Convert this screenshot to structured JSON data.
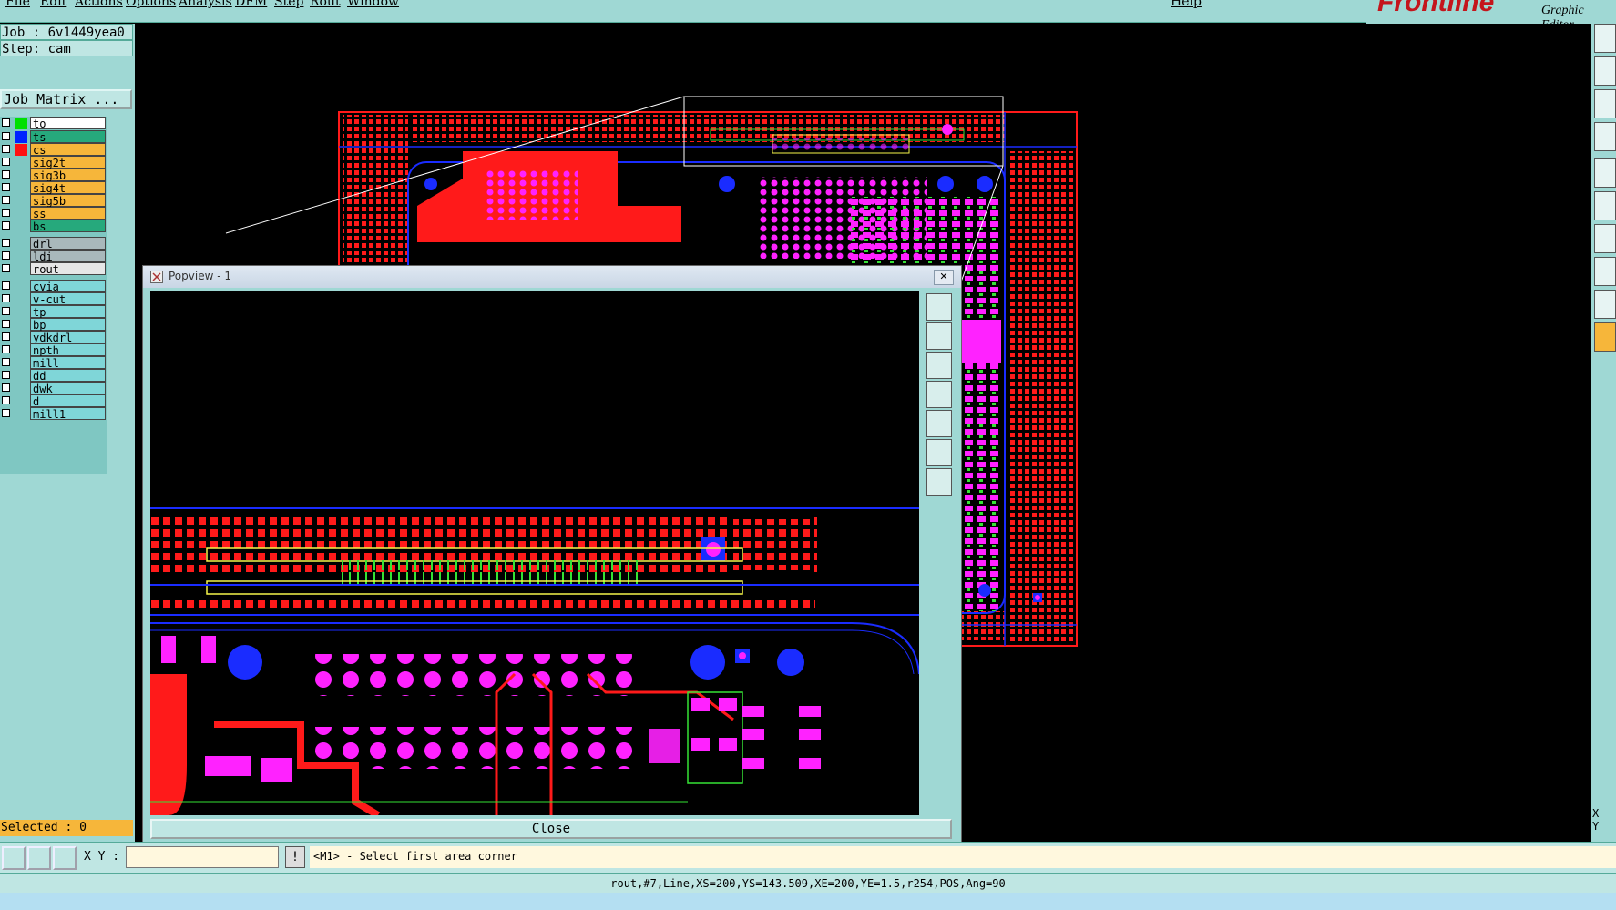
{
  "menu": [
    "File",
    "Edit",
    "Actions",
    "Options",
    "Analysis",
    "DFM",
    "Step",
    "Rout",
    "Window",
    "Help"
  ],
  "brand": {
    "logo": "Frontline",
    "subtitle": "Graphic Editor"
  },
  "job": {
    "job_label": "Job : 6v1449yea0",
    "step_label": "Step: cam",
    "matrix_button": "Job Matrix ..."
  },
  "layers": [
    {
      "name": "to",
      "swatch": "#00e000",
      "bg": "#ffffff"
    },
    {
      "name": "ts",
      "swatch": "#0022ff",
      "bg": "#26a97c"
    },
    {
      "name": "cs",
      "swatch": "#ff1111",
      "bg": "#f6b63a"
    },
    {
      "name": "sig2t",
      "swatch": "",
      "bg": "#f6b63a"
    },
    {
      "name": "sig3b",
      "swatch": "",
      "bg": "#f6b63a"
    },
    {
      "name": "sig4t",
      "swatch": "",
      "bg": "#f6b63a"
    },
    {
      "name": "sig5b",
      "swatch": "",
      "bg": "#f6b63a"
    },
    {
      "name": "ss",
      "swatch": "",
      "bg": "#f6b63a"
    },
    {
      "name": "bs",
      "swatch": "",
      "bg": "#26a97c"
    },
    {
      "name": "drl",
      "swatch": "",
      "bg": "#a9b8bb"
    },
    {
      "name": "ldi",
      "swatch": "",
      "bg": "#a9b8bb"
    },
    {
      "name": "rout",
      "swatch": "",
      "bg": "#e6e6e6"
    },
    {
      "name": "cvia",
      "swatch": "",
      "bg": "#7fd6d8"
    },
    {
      "name": "v-cut",
      "swatch": "",
      "bg": "#7fd6d8"
    },
    {
      "name": "tp",
      "swatch": "",
      "bg": "#7fd6d8"
    },
    {
      "name": "bp",
      "swatch": "",
      "bg": "#7fd6d8"
    },
    {
      "name": "ydkdrl",
      "swatch": "",
      "bg": "#7fd6d8"
    },
    {
      "name": "npth",
      "swatch": "",
      "bg": "#7fd6d8"
    },
    {
      "name": "mill",
      "swatch": "",
      "bg": "#7fd6d8"
    },
    {
      "name": "dd",
      "swatch": "",
      "bg": "#7fd6d8"
    },
    {
      "name": "dwk",
      "swatch": "",
      "bg": "#7fd6d8"
    },
    {
      "name": "d",
      "swatch": "",
      "bg": "#7fd6d8"
    },
    {
      "name": "mill1",
      "swatch": "",
      "bg": "#7fd6d8"
    }
  ],
  "selected_label": "Selected : 0",
  "popview": {
    "title": "Popview - 1",
    "close_label": "Close"
  },
  "bottom": {
    "xy_label": "X Y :",
    "prompt": "<M1> - Select first area corner"
  },
  "status": "rout,#7,Line,XS=200,YS=143.509,XE=200,YE=1.5,r254,POS,Ang=90",
  "right_xy": {
    "x": "X",
    "y": "Y"
  },
  "colors": {
    "panel": "#9fd8d4",
    "copper": "#ff1a1a",
    "pad": "#ff22ff",
    "via": "#1a2cff",
    "outline": "#35e235",
    "prompt_bg": "#fff8de"
  }
}
